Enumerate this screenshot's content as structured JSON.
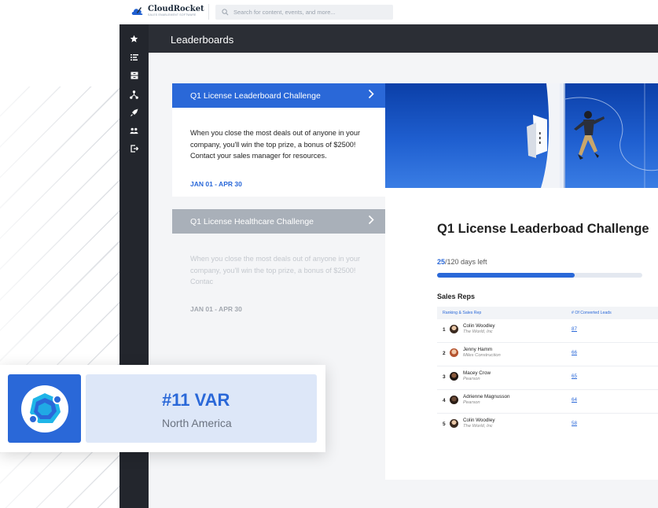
{
  "app": {
    "brand": "CloudRocket",
    "brand_tagline": "SALES ENABLEMENT SOFTWARE",
    "search_placeholder": "Search for content, events, and more..."
  },
  "sidebar": {
    "icons": [
      "star-icon",
      "list-icon",
      "archive-icon",
      "network-icon",
      "rocket-icon",
      "users-icon",
      "logout-icon"
    ]
  },
  "header": {
    "title": "Leaderboards"
  },
  "challenges": [
    {
      "title": "Q1 License Leaderboard Challenge",
      "description": "When you close the most deals out of anyone in your company, you'll win the top prize, a bonus of $2500! Contact your sales manager for resources.",
      "date_range": "JAN 01 - APR 30",
      "active": true
    },
    {
      "title": "Q1 License Healthcare Challenge",
      "description": "When you close the most deals out of anyone in your company, you'll win the top prize, a bonus of $2500! Contac",
      "date_range": "JAN 01 - APR 30",
      "active": false
    }
  ],
  "detail": {
    "title": "Q1 License Leaderboad Challenge",
    "days_elapsed": "25",
    "days_total_text": "/120 days left",
    "progress_fraction": 0.67,
    "section_title": "Sales Reps",
    "columns": [
      "Ranking & Sales Rep",
      "# Of Converted Leads"
    ],
    "reps": [
      {
        "rank": "1",
        "name": "Colin Woodley",
        "company": "The World, Inc",
        "leads": "87"
      },
      {
        "rank": "2",
        "name": "Jenny Hamm",
        "company": "Miles Construction",
        "leads": "66"
      },
      {
        "rank": "3",
        "name": "Macey Crow",
        "company": "Pearson",
        "leads": "65"
      },
      {
        "rank": "4",
        "name": "Adrienne Magnusson",
        "company": "Pearson",
        "leads": "64"
      },
      {
        "rank": "5",
        "name": "Colin Woodley",
        "company": "The World, Inc",
        "leads": "58"
      }
    ]
  },
  "rank_card": {
    "rank": "#11 VAR",
    "region": "North America"
  },
  "colors": {
    "accent": "#2a68d8",
    "sidebar": "#23262d",
    "header": "#2b2e35",
    "inactive_tab": "#a9b0b9"
  }
}
